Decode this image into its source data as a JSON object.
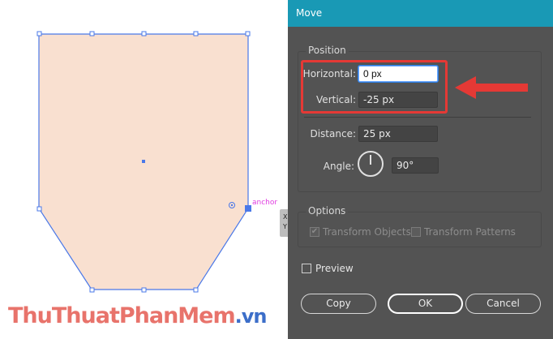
{
  "dialog": {
    "title": "Move",
    "position_section": "Position",
    "horizontal_label": "Horizontal:",
    "horizontal_value": "0 px",
    "vertical_label": "Vertical:",
    "vertical_value": "-25 px",
    "distance_label": "Distance:",
    "distance_value": "25 px",
    "angle_label": "Angle:",
    "angle_value": "90°",
    "options_section": "Options",
    "transform_objects_label": "Transform Objects",
    "transform_objects_checked": true,
    "transform_patterns_label": "Transform Patterns",
    "transform_patterns_checked": false,
    "preview_label": "Preview",
    "preview_checked": false,
    "copy_label": "Copy",
    "ok_label": "OK",
    "cancel_label": "Cancel"
  },
  "canvas": {
    "anchor_label": "anchor",
    "tooltip_text": "X Y",
    "shape_fill": "#f9e0d0",
    "selection_color": "#4a78e8"
  },
  "watermark": {
    "main": "ThuThuatPhanMem",
    "ext": ".vn"
  },
  "colors": {
    "titlebar": "#1999b5",
    "dialog_bg": "#535353",
    "highlight": "#e53935"
  },
  "icons": {
    "arrow": "arrow-left-icon",
    "dial": "angle-dial-icon",
    "check": "check-icon"
  }
}
